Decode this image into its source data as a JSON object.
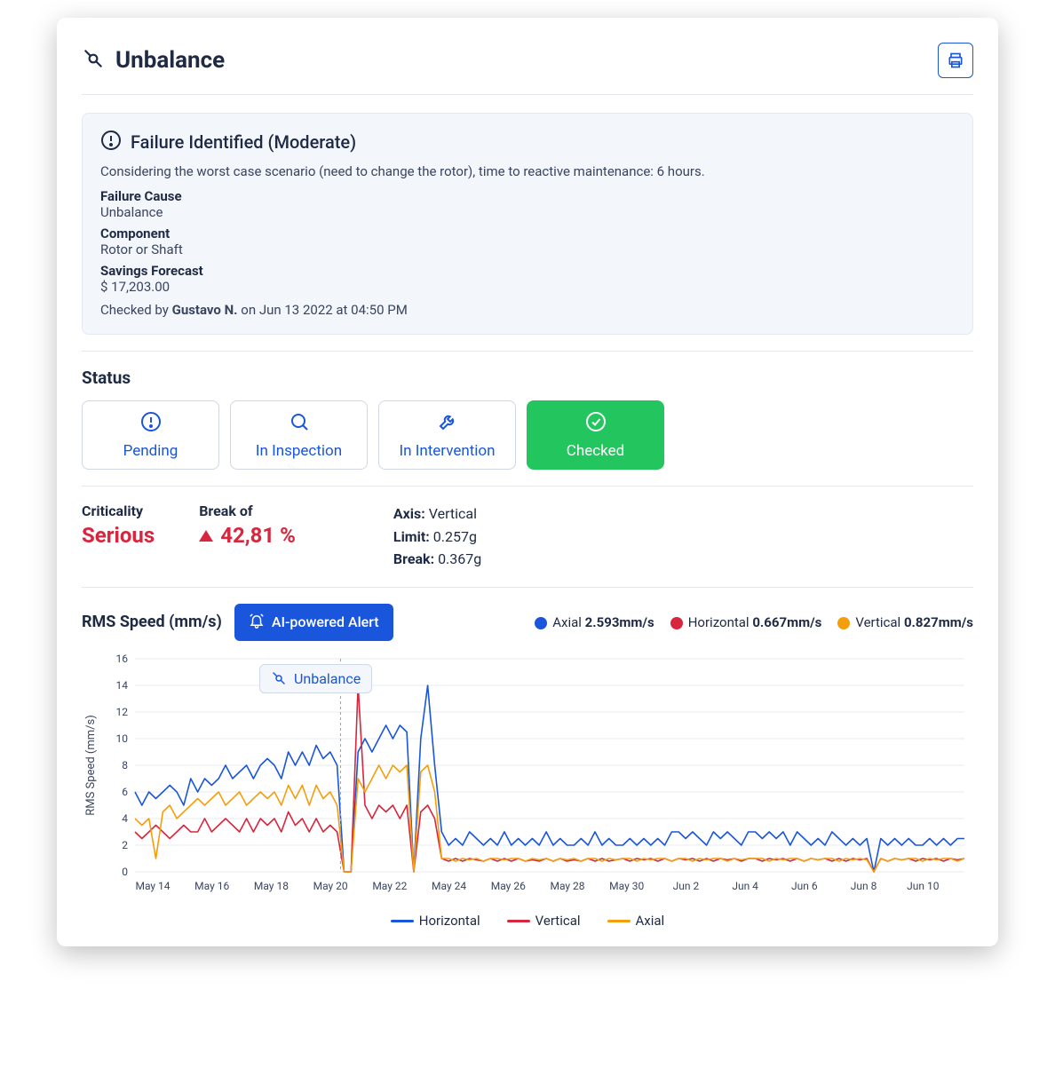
{
  "header": {
    "title": "Unbalance"
  },
  "info": {
    "heading": "Failure Identified (Moderate)",
    "description": "Considering the worst case scenario (need to change the rotor), time to reactive maintenance: 6 hours.",
    "fields": [
      {
        "label": "Failure Cause",
        "value": "Unbalance"
      },
      {
        "label": "Component",
        "value": "Rotor or Shaft"
      },
      {
        "label": "Savings Forecast",
        "value": "$ 17,203.00"
      }
    ],
    "checked_prefix": "Checked by ",
    "checked_name": "Gustavo N.",
    "checked_suffix": " on Jun 13 2022 at 04:50 PM"
  },
  "status": {
    "heading": "Status",
    "options": [
      {
        "label": "Pending",
        "icon": "alert",
        "active": false
      },
      {
        "label": "In Inspection",
        "icon": "search",
        "active": false
      },
      {
        "label": "In Intervention",
        "icon": "wrench",
        "active": false
      },
      {
        "label": "Checked",
        "icon": "check",
        "active": true
      }
    ]
  },
  "metrics": {
    "criticality_label": "Criticality",
    "criticality_value": "Serious",
    "break_label": "Break of",
    "break_value": "42,81 %",
    "axis": {
      "axis_label": "Axis:",
      "axis_value": " Vertical",
      "limit_label": "Limit:",
      "limit_value": " 0.257g",
      "break_label": "Break:",
      "break_value": " 0.367g"
    }
  },
  "chart": {
    "title": "RMS Speed (mm/s)",
    "ai_button": "AI-powered Alert",
    "tag": "Unbalance",
    "legend_top": [
      {
        "name": "Axial",
        "value": "2.593mm/s",
        "color": "#1a56db"
      },
      {
        "name": "Horizontal",
        "value": "0.667mm/s",
        "color": "#d7263d"
      },
      {
        "name": "Vertical",
        "value": "0.827mm/s",
        "color": "#f59e0b"
      }
    ],
    "legend_bottom": [
      {
        "name": "Horizontal",
        "color": "#1a56db"
      },
      {
        "name": "Vertical",
        "color": "#d7263d"
      },
      {
        "name": "Axial",
        "color": "#f59e0b"
      }
    ],
    "colors": {
      "horizontal": "#1a56db",
      "vertical": "#d7263d",
      "axial": "#f59e0b"
    }
  },
  "chart_data": {
    "type": "line",
    "title": "RMS Speed (mm/s)",
    "xlabel": "",
    "ylabel": "RMS Speed (mm/s)",
    "ylim": [
      0,
      16
    ],
    "yticks": [
      0,
      2,
      4,
      6,
      8,
      10,
      12,
      14,
      16
    ],
    "xticks": [
      "May 14",
      "May 16",
      "May 18",
      "May 20",
      "May 22",
      "May 24",
      "May 26",
      "May 28",
      "May 30",
      "Jun 2",
      "Jun 4",
      "Jun 6",
      "Jun 8",
      "Jun 10"
    ],
    "x": [
      1,
      2,
      3,
      4,
      5,
      6,
      7,
      8,
      9,
      10,
      11,
      12,
      13,
      14,
      15,
      16,
      17,
      18,
      19,
      20,
      21,
      22,
      23,
      24,
      25,
      26,
      27,
      28,
      29,
      30,
      31,
      32,
      33,
      34,
      35,
      36,
      37,
      38,
      39,
      40,
      41,
      42,
      43,
      44,
      45,
      46,
      47,
      48,
      49,
      50,
      51,
      52,
      53,
      54,
      55,
      56,
      57,
      58,
      59,
      60,
      61,
      62,
      63,
      64,
      65,
      66,
      67,
      68,
      69,
      70,
      71,
      72,
      73,
      74,
      75,
      76,
      77,
      78,
      79,
      80,
      81,
      82,
      83,
      84,
      85,
      86,
      87,
      88,
      89,
      90,
      91,
      92,
      93,
      94,
      95,
      96,
      97,
      98,
      99,
      100,
      101,
      102,
      103,
      104,
      105,
      106,
      107,
      108,
      109,
      110,
      111,
      112,
      113,
      114,
      115,
      116,
      117,
      118,
      119,
      120
    ],
    "series": [
      {
        "name": "Horizontal",
        "color": "#1a56db",
        "values": [
          6,
          5,
          6,
          5.5,
          6,
          6.5,
          6,
          5,
          7,
          6,
          7,
          6.5,
          7,
          8,
          7,
          7.5,
          8,
          7,
          8,
          8.5,
          8,
          7,
          9,
          8,
          9,
          8,
          9.5,
          8.5,
          9,
          8,
          0,
          0,
          9,
          10,
          9,
          10,
          11,
          10,
          11,
          10.5,
          0,
          10,
          14,
          8,
          3,
          2,
          2.5,
          2,
          3,
          2.5,
          2,
          2.5,
          2,
          3,
          2,
          2.5,
          2,
          2.5,
          2,
          3,
          2,
          2.5,
          2,
          2,
          2.5,
          2,
          3,
          2,
          2.5,
          2,
          2,
          2.5,
          2,
          2.5,
          2,
          2.5,
          2,
          3,
          3,
          2.5,
          3,
          2.5,
          2,
          3,
          2.5,
          3,
          2.5,
          2,
          3,
          3,
          2.5,
          3,
          2.5,
          3,
          2,
          3,
          2.5,
          2,
          2.5,
          2,
          3,
          2.5,
          2,
          2.5,
          2,
          2.5,
          0,
          2.5,
          2,
          2.5,
          2,
          2.5,
          2,
          2,
          2.5,
          2,
          2.5,
          2,
          2.5,
          2.5
        ]
      },
      {
        "name": "Vertical",
        "color": "#d7263d",
        "values": [
          3,
          2.5,
          3,
          3.5,
          3,
          2.5,
          3,
          3.5,
          3,
          3,
          4,
          3,
          3.5,
          4,
          3.5,
          3,
          4,
          3,
          4,
          3.5,
          4,
          3,
          4.5,
          3.5,
          4,
          3,
          4,
          3,
          3.5,
          3,
          0,
          0,
          14,
          5,
          4,
          5,
          4.5,
          5,
          4,
          5,
          0,
          4.5,
          5,
          4,
          1,
          0.8,
          1,
          0.8,
          1,
          0.9,
          0.8,
          1,
          0.8,
          1,
          0.8,
          1,
          0.8,
          0.9,
          0.8,
          1,
          0.8,
          1,
          0.8,
          0.9,
          0.8,
          1,
          0.8,
          1,
          0.8,
          0.9,
          1,
          0.8,
          1,
          0.9,
          1,
          0.8,
          1,
          0.8,
          1,
          0.9,
          1,
          0.8,
          1,
          0.8,
          1,
          0.9,
          1,
          0.8,
          1,
          1,
          0.8,
          1,
          0.9,
          1,
          0.8,
          1,
          0.8,
          1,
          0.9,
          1,
          0.8,
          1,
          0.8,
          1,
          0.9,
          1,
          0,
          1,
          0.8,
          1,
          0.9,
          1,
          0.8,
          1,
          0.9,
          1,
          0.8,
          1,
          0.9,
          1
        ]
      },
      {
        "name": "Axial",
        "color": "#f59e0b",
        "values": [
          4,
          3.5,
          4,
          1,
          4.5,
          5,
          4,
          4.5,
          5,
          5.5,
          5,
          5.5,
          6,
          5,
          5.5,
          6,
          5,
          5.5,
          6,
          5.5,
          6,
          5,
          6.5,
          5.5,
          6.5,
          5,
          6.5,
          5.5,
          6,
          5,
          0,
          0,
          7,
          6,
          7,
          8,
          7,
          8,
          7.5,
          8,
          0,
          7.5,
          8,
          6,
          1,
          1,
          0.8,
          1,
          0.9,
          1,
          0.8,
          1,
          1,
          0.9,
          1,
          1,
          0.8,
          1,
          0.9,
          1,
          0.8,
          1,
          0.9,
          1,
          0.8,
          1,
          1,
          0.8,
          1,
          0.9,
          1,
          1,
          0.8,
          1,
          0.9,
          1,
          1,
          0.8,
          1,
          1,
          0.8,
          1,
          0.9,
          1,
          1,
          0.8,
          1,
          0.9,
          1,
          1,
          1,
          0.8,
          1,
          0.9,
          1,
          1,
          0.8,
          1,
          0.9,
          1,
          1,
          0.8,
          1,
          0.9,
          1,
          0.9,
          0,
          1,
          0.8,
          1,
          0.9,
          1,
          1,
          0.8,
          1,
          0.9,
          1,
          1,
          0.8,
          1
        ]
      }
    ]
  }
}
